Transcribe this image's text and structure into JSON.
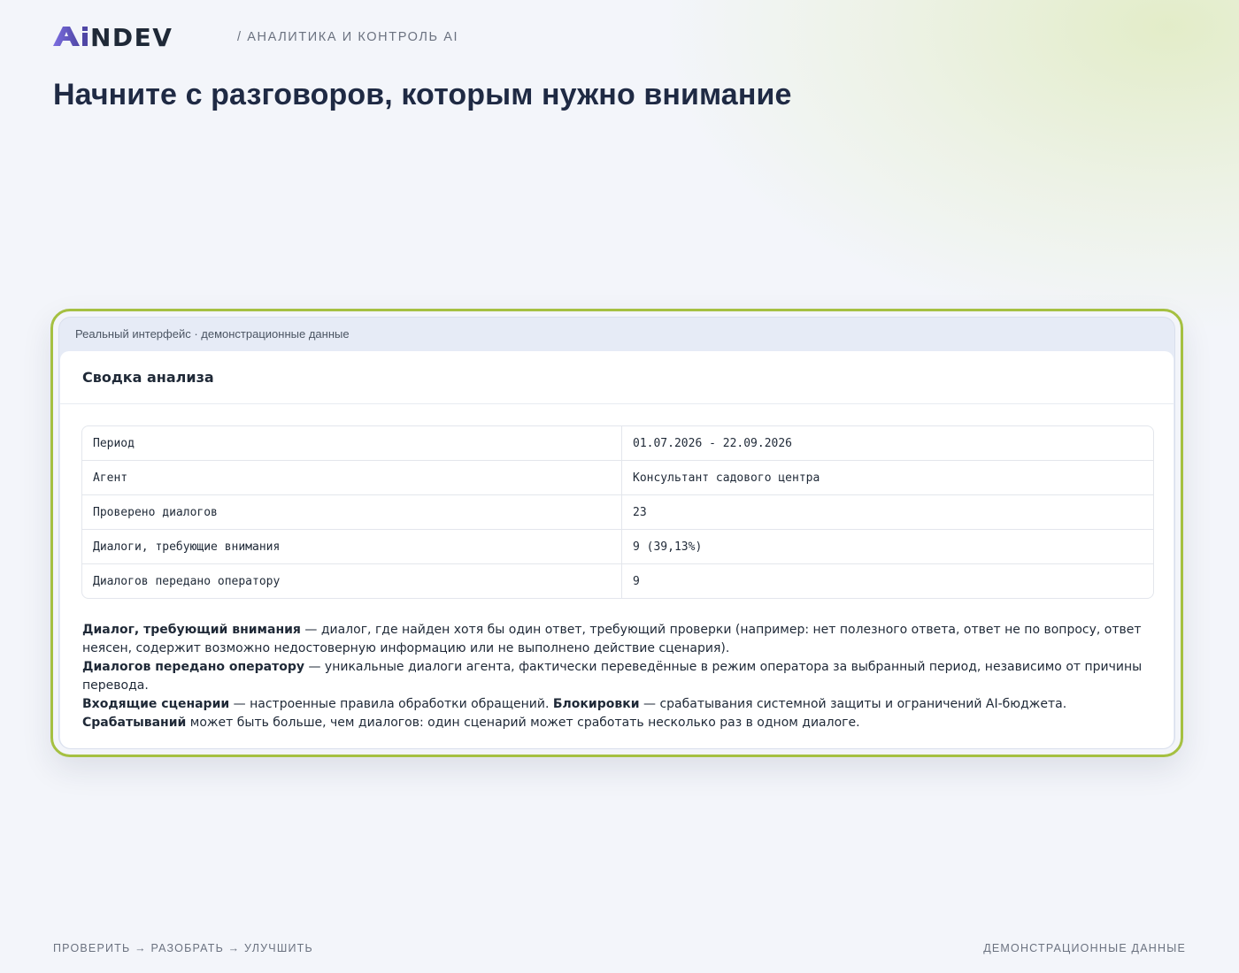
{
  "header": {
    "logo_text": "AiNDEV",
    "tagline": "/ АНАЛИТИКА И КОНТРОЛЬ AI",
    "logo_colors": {
      "gradient_start": "#6d5fd0",
      "gradient_end": "#4f46a5",
      "text": "#1f2937"
    }
  },
  "hero": {
    "title": "Начните с разговоров, которым нужно внимание"
  },
  "demo_frame": {
    "caption": "Реальный интерфейс · демонстрационные данные",
    "accent_color": "#a5c041"
  },
  "panel": {
    "title": "Сводка анализа",
    "rows": [
      {
        "label": "Период",
        "value": "01.07.2026 - 22.09.2026"
      },
      {
        "label": "Агент",
        "value": "Консультант садового центра"
      },
      {
        "label": "Проверено диалогов",
        "value": "23"
      },
      {
        "label": "Диалоги, требующие внимания",
        "value": "9 (39,13%)"
      },
      {
        "label": "Диалогов передано оператору",
        "value": "9"
      }
    ],
    "notes": {
      "n1_term": "Диалог, требующий внимания",
      "n1_text": " — диалог, где найден хотя бы один ответ, требующий проверки (например: нет полезного ответа, ответ не по вопросу, ответ неясен, содержит возможно недостоверную информацию или не выполнено действие сценария).",
      "n2_term": "Диалогов передано оператору",
      "n2_text": " — уникальные диалоги агента, фактически переведённые в режим оператора за выбранный период, независимо от причины перевода.",
      "n3_term": "Входящие сценарии",
      "n3_text": " — настроенные правила обработки обращений. ",
      "n3_term2": "Блокировки",
      "n3_text2": " — срабатывания системной защиты и ограничений AI-бюджета.",
      "n4_term": "Срабатываний",
      "n4_text": " может быть больше, чем диалогов: один сценарий может сработать несколько раз в одном диалоге."
    }
  },
  "footer": {
    "left": "ПРОВЕРИТЬ → РАЗОБРАТЬ → УЛУЧШИТЬ",
    "right": "ДЕМОНСТРАЦИОННЫЕ ДАННЫЕ"
  }
}
